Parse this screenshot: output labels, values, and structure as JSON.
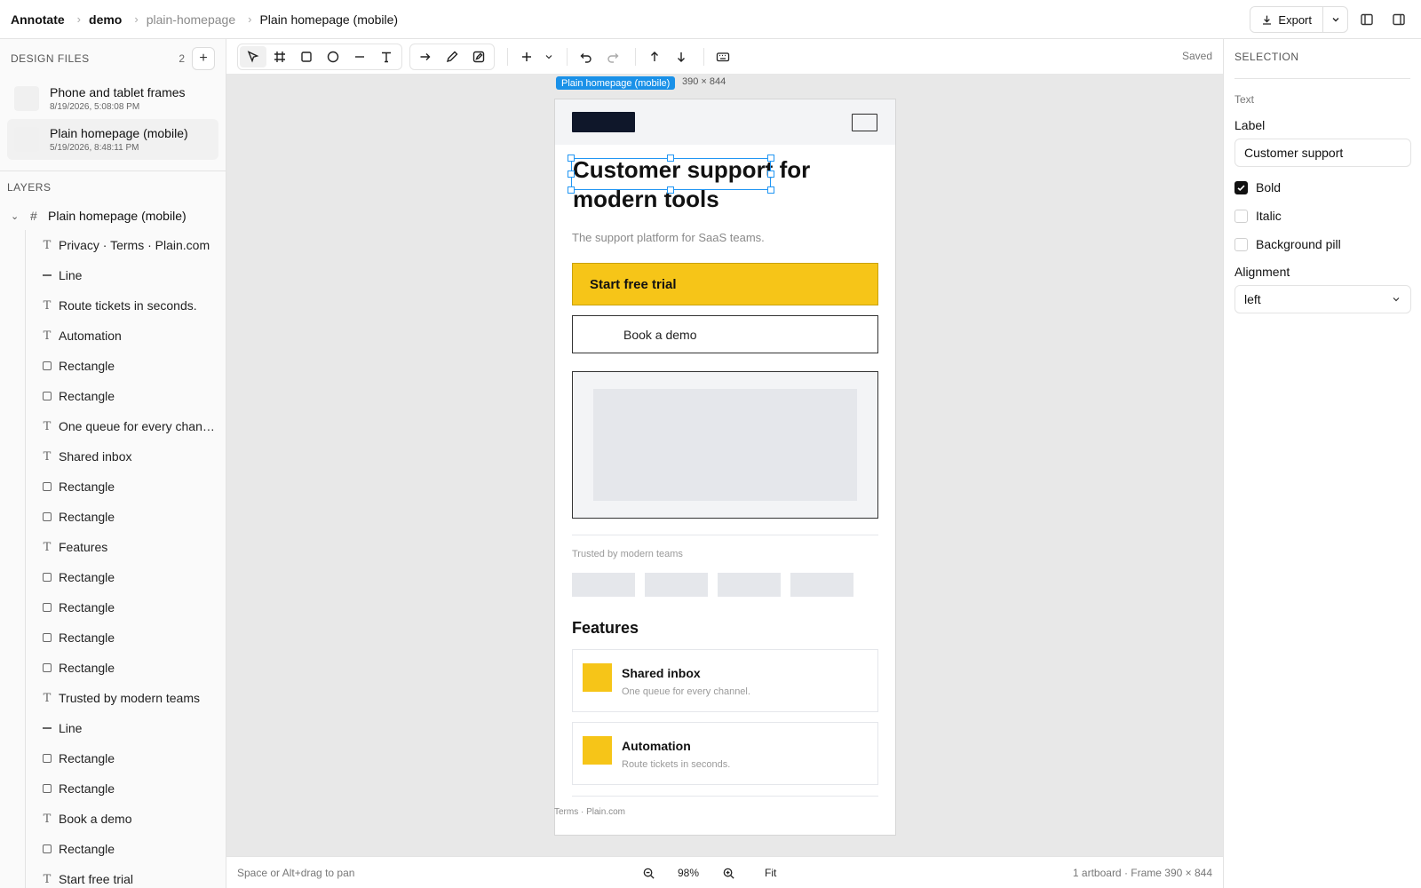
{
  "header": {
    "brand": "Annotate",
    "breadcrumbs": [
      "demo",
      "plain-homepage",
      "Plain homepage (mobile)"
    ],
    "export_label": "Export"
  },
  "sidebar": {
    "design_files_title": "DESIGN FILES",
    "design_files_count": "2",
    "files": [
      {
        "name": "Phone and tablet frames",
        "date": "8/19/2026, 5:08:08 PM",
        "active": false
      },
      {
        "name": "Plain homepage (mobile)",
        "date": "5/19/2026, 8:48:11 PM",
        "active": true
      }
    ],
    "layers_title": "LAYERS",
    "root_layer": "Plain homepage (mobile)",
    "layers": [
      {
        "type": "text",
        "name": "Privacy · Terms · Plain.com"
      },
      {
        "type": "line",
        "name": "Line"
      },
      {
        "type": "text",
        "name": "Route tickets in seconds."
      },
      {
        "type": "text",
        "name": "Automation"
      },
      {
        "type": "rect",
        "name": "Rectangle"
      },
      {
        "type": "rect",
        "name": "Rectangle"
      },
      {
        "type": "text",
        "name": "One queue for every chan…"
      },
      {
        "type": "text",
        "name": "Shared inbox"
      },
      {
        "type": "rect",
        "name": "Rectangle"
      },
      {
        "type": "rect",
        "name": "Rectangle"
      },
      {
        "type": "text",
        "name": "Features"
      },
      {
        "type": "rect",
        "name": "Rectangle"
      },
      {
        "type": "rect",
        "name": "Rectangle"
      },
      {
        "type": "rect",
        "name": "Rectangle"
      },
      {
        "type": "rect",
        "name": "Rectangle"
      },
      {
        "type": "text",
        "name": "Trusted by modern teams"
      },
      {
        "type": "line",
        "name": "Line"
      },
      {
        "type": "rect",
        "name": "Rectangle"
      },
      {
        "type": "rect",
        "name": "Rectangle"
      },
      {
        "type": "text",
        "name": "Book a demo"
      },
      {
        "type": "rect",
        "name": "Rectangle"
      },
      {
        "type": "text",
        "name": "Start free trial"
      }
    ]
  },
  "toolbar": {
    "tools": [
      "select-tool",
      "frame-tool",
      "rectangle-tool",
      "ellipse-tool",
      "line-tool",
      "text-tool"
    ],
    "saved_label": "Saved"
  },
  "canvas": {
    "frame_label": "Plain homepage (mobile)",
    "frame_size": "390 × 844",
    "artboard": {
      "headline": "Customer support for modern tools",
      "subtitle": "The support platform for SaaS teams.",
      "cta_primary": "Start free trial",
      "cta_secondary": "Book a demo",
      "trusted": "Trusted by modern teams",
      "features_heading": "Features",
      "cards": [
        {
          "title": "Shared inbox",
          "desc": "One queue for every channel."
        },
        {
          "title": "Automation",
          "desc": "Route tickets in seconds."
        }
      ],
      "footer": "Terms · Plain.com"
    }
  },
  "statusbar": {
    "hint": "Space or Alt+drag to pan",
    "zoom": "98%",
    "fit_label": "Fit",
    "info": "1 artboard · Frame 390 × 844"
  },
  "panel": {
    "title": "SELECTION",
    "kind": "Text",
    "label_title": "Label",
    "label_value": "Customer support",
    "bold_label": "Bold",
    "bold_checked": true,
    "italic_label": "Italic",
    "italic_checked": false,
    "pill_label": "Background pill",
    "pill_checked": false,
    "alignment_title": "Alignment",
    "alignment_value": "left"
  },
  "colors": {
    "accent": "#1a91e8",
    "cta_yellow": "#f6c518",
    "logo_dark": "#0f172a"
  }
}
